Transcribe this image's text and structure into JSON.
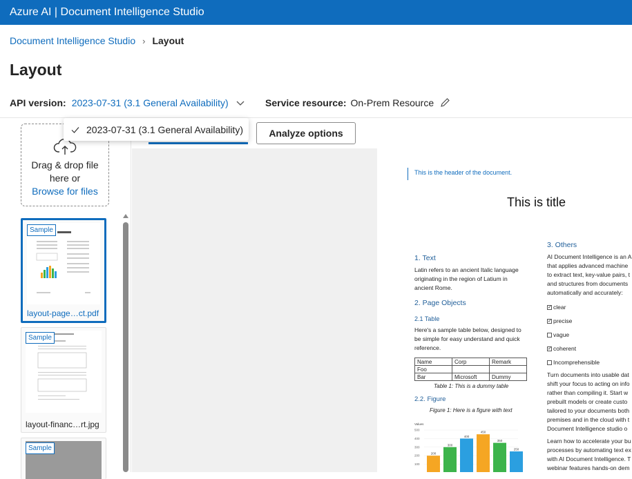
{
  "app": {
    "title": "Azure AI | Document Intelligence Studio"
  },
  "breadcrumb": {
    "root": "Document Intelligence Studio",
    "current": "Layout"
  },
  "page": {
    "title": "Layout"
  },
  "api": {
    "label": "API version:",
    "value": "2023-07-31 (3.1 General Availability)"
  },
  "service": {
    "label": "Service resource:",
    "value": "On-Prem Resource"
  },
  "dropdown": {
    "options": [
      "2023-07-31 (3.1 General Availability)"
    ],
    "selected": "2023-07-31 (3.1 General Availability)"
  },
  "toolbar": {
    "analyze_options": "Analyze options"
  },
  "upload": {
    "line1": "Drag & drop file",
    "line2": "here or",
    "browse": "Browse for files"
  },
  "files": [
    {
      "badge": "Sample",
      "name": "layout-page…ct.pdf",
      "selected": true
    },
    {
      "badge": "Sample",
      "name": "layout-financ…rt.jpg",
      "selected": false
    },
    {
      "badge": "Sample",
      "name": "",
      "selected": false
    }
  ],
  "document": {
    "header": "This is the header of the document.",
    "title": "This is title",
    "s1_heading": "1. Text",
    "s1_lines": [
      "Latin refers to an ancient Italic language",
      "originating in the region of Latium in",
      "ancient Rome."
    ],
    "s2_heading": "2. Page Objects",
    "s21_heading": "2.1 Table",
    "s21_lines": [
      "Here's a sample table below, designed to",
      "be simple for easy understand and quick",
      "reference."
    ],
    "table": [
      [
        "Name",
        "Corp",
        "Remark"
      ],
      [
        "Foo",
        "",
        ""
      ],
      [
        "Bar",
        "Microsoft",
        "Dummy"
      ]
    ],
    "table_caption": "Table 1: This is a dummy table",
    "s22_heading": "2.2. Figure",
    "figure_caption": "Figure 1: Here is a figure with text",
    "s3_heading": "3. Others",
    "s3_lines": [
      "AI Document Intelligence is an A",
      "that applies advanced machine",
      "to extract text, key-value pairs, t",
      "and structures from documents",
      "automatically and accurately:"
    ],
    "checklist": [
      {
        "label": "clear",
        "checked": true
      },
      {
        "label": "precise",
        "checked": true
      },
      {
        "label": "vague",
        "checked": false
      },
      {
        "label": "coherent",
        "checked": true
      },
      {
        "label": "Incomprehensible",
        "checked": false
      }
    ],
    "s3_para2": [
      "Turn documents into usable dat",
      "shift your focus to acting on info",
      "rather than compiling it. Start w",
      "prebuilt models or create custo",
      "tailored to your documents both",
      "premises and in the cloud with t",
      "Document Intelligence studio o"
    ],
    "s3_para3": [
      "Learn how to accelerate your bu",
      "processes by automating text ex",
      "with AI Document Intelligence. T",
      "webinar features hands-on dem"
    ]
  },
  "chart_data": {
    "type": "bar",
    "title": "",
    "ylabel": "Values",
    "yticks": [
      "500",
      "400",
      "300",
      "200",
      "100"
    ],
    "values": [
      200,
      300,
      400,
      450,
      350,
      250
    ],
    "data_labels": [
      "200",
      "300",
      "400",
      "450",
      "350",
      "250"
    ],
    "ylim": [
      0,
      500
    ],
    "colors": [
      "#f5a623",
      "#3cb44b",
      "#2b9fe0",
      "#f5a623",
      "#3cb44b",
      "#2b9fe0"
    ]
  }
}
